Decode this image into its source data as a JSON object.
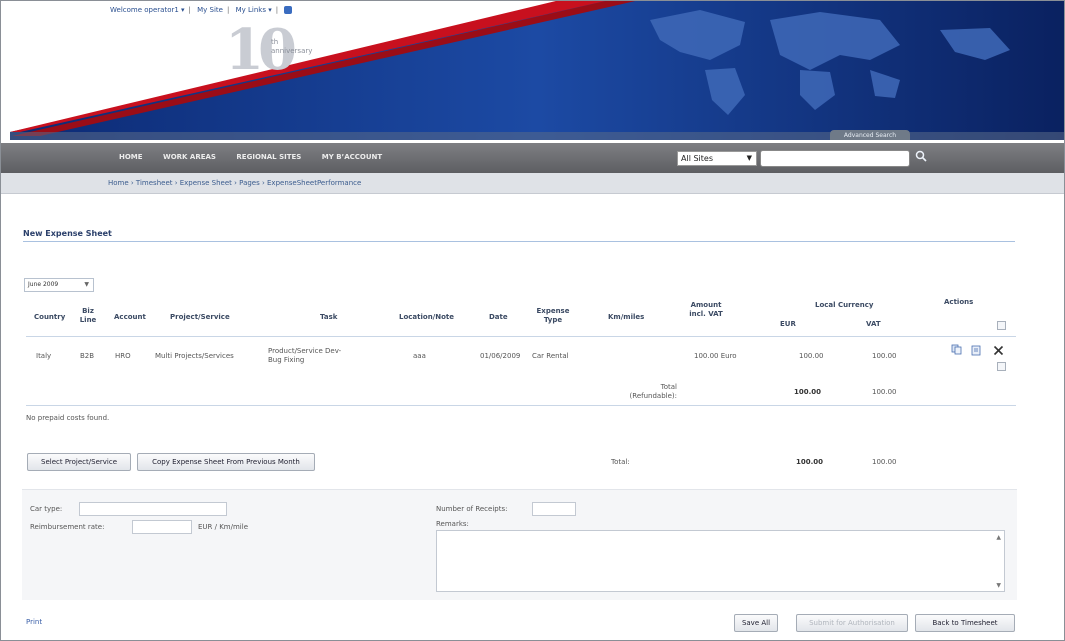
{
  "header": {
    "top_links": [
      "Welcome operator1 ▾",
      "My Site",
      "My Links ▾"
    ],
    "logo_number": "10",
    "logo_text": [
      "th",
      "anniversary"
    ],
    "advanced_search": "Advanced Search"
  },
  "nav": {
    "items": [
      "HOME",
      "WORK AREAS",
      "REGIONAL SITES",
      "MY B’ACCOUNT"
    ],
    "site_scope": "All Sites",
    "search_value": ""
  },
  "breadcrumb": "Home › Timesheet › Expense Sheet › Pages › ExpenseSheetPerformance",
  "page_title": "New Expense Sheet",
  "month_select": "June 2009",
  "table": {
    "headers": {
      "country": "Country",
      "biz_line": "Biz Line",
      "account": "Account",
      "project": "Project/Service",
      "task": "Task",
      "location": "Location/Note",
      "date": "Date",
      "expense_type": "Expense Type",
      "km": "Km/miles",
      "amount": "Amount incl. VAT",
      "local_currency": "Local Currency",
      "eur": "EUR",
      "vat": "VAT",
      "actions": "Actions"
    },
    "row": {
      "country": "Italy",
      "biz_line": "B2B",
      "account": "HRO",
      "project": "Multi Projects/Services",
      "task": "Product/Service Dev-Bug Fixing",
      "location": "aaa",
      "date": "01/06/2009",
      "expense_type": "Car Rental",
      "km": "",
      "amount": "100.00 Euro",
      "eur": "100.00",
      "vat": "100.00"
    },
    "total_label": "Total (Refundable):",
    "total_eur": "100.00",
    "total_vat": "100.00"
  },
  "no_prepaid": "No prepaid costs found.",
  "buttons": {
    "select_project": "Select Project/Service",
    "copy_sheet": "Copy Expense Sheet From Previous Month",
    "save_all": "Save All",
    "submit": "Submit for Authorisation",
    "back": "Back to Timesheet"
  },
  "grand_total": {
    "label": "Total:",
    "eur": "100.00",
    "vat": "100.00"
  },
  "form": {
    "car_type_label": "Car type:",
    "car_type_value": "",
    "reimbursement_label": "Reimbursement rate:",
    "reimbursement_value": "",
    "reimbursement_unit": "EUR / Km/mile",
    "receipts_label": "Number of Receipts:",
    "receipts_value": "",
    "remarks_label": "Remarks:",
    "remarks_value": ""
  },
  "print_link": "Print",
  "colors": {
    "banner_navy": "#0e2a6e",
    "banner_red": "#c8101e",
    "nav_gray": "#6b6c70",
    "link_blue": "#3a5fa8"
  }
}
